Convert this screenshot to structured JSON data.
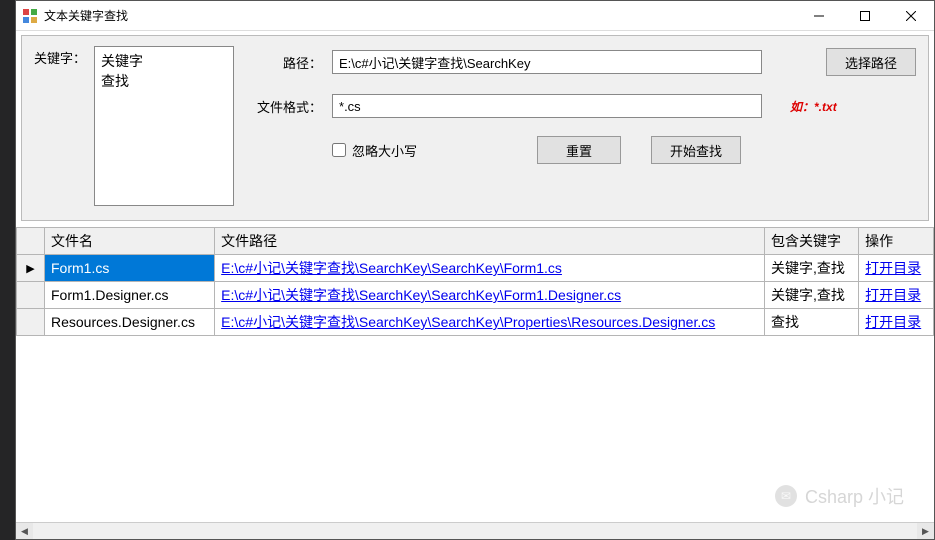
{
  "window": {
    "title": "文本关键字查找"
  },
  "form": {
    "keyword_label": "关键字：",
    "keyword_text": "关键字\n查找",
    "path_label": "路径：",
    "path_value": "E:\\c#小记\\关键字查找\\SearchKey",
    "choose_path_btn": "选择路径",
    "format_label": "文件格式：",
    "format_value": "*.cs",
    "format_hint": "如：*.txt",
    "ignore_case_label": "忽略大小写",
    "ignore_case_checked": false,
    "reset_btn": "重置",
    "search_btn": "开始查找"
  },
  "grid": {
    "headers": {
      "filename": "文件名",
      "filepath": "文件路径",
      "keywords": "包含关键字",
      "action": "操作"
    },
    "action_label": "打开目录",
    "rows": [
      {
        "filename": "Form1.cs",
        "filepath": "E:\\c#小记\\关键字查找\\SearchKey\\SearchKey\\Form1.cs",
        "keywords": "关键字,查找",
        "selected": true
      },
      {
        "filename": "Form1.Designer.cs",
        "filepath": "E:\\c#小记\\关键字查找\\SearchKey\\SearchKey\\Form1.Designer.cs",
        "keywords": "关键字,查找",
        "selected": false
      },
      {
        "filename": "Resources.Designer.cs",
        "filepath": "E:\\c#小记\\关键字查找\\SearchKey\\SearchKey\\Properties\\Resources.Designer.cs",
        "keywords": "查找",
        "selected": false
      }
    ]
  },
  "watermark": {
    "text": "Csharp 小记"
  }
}
